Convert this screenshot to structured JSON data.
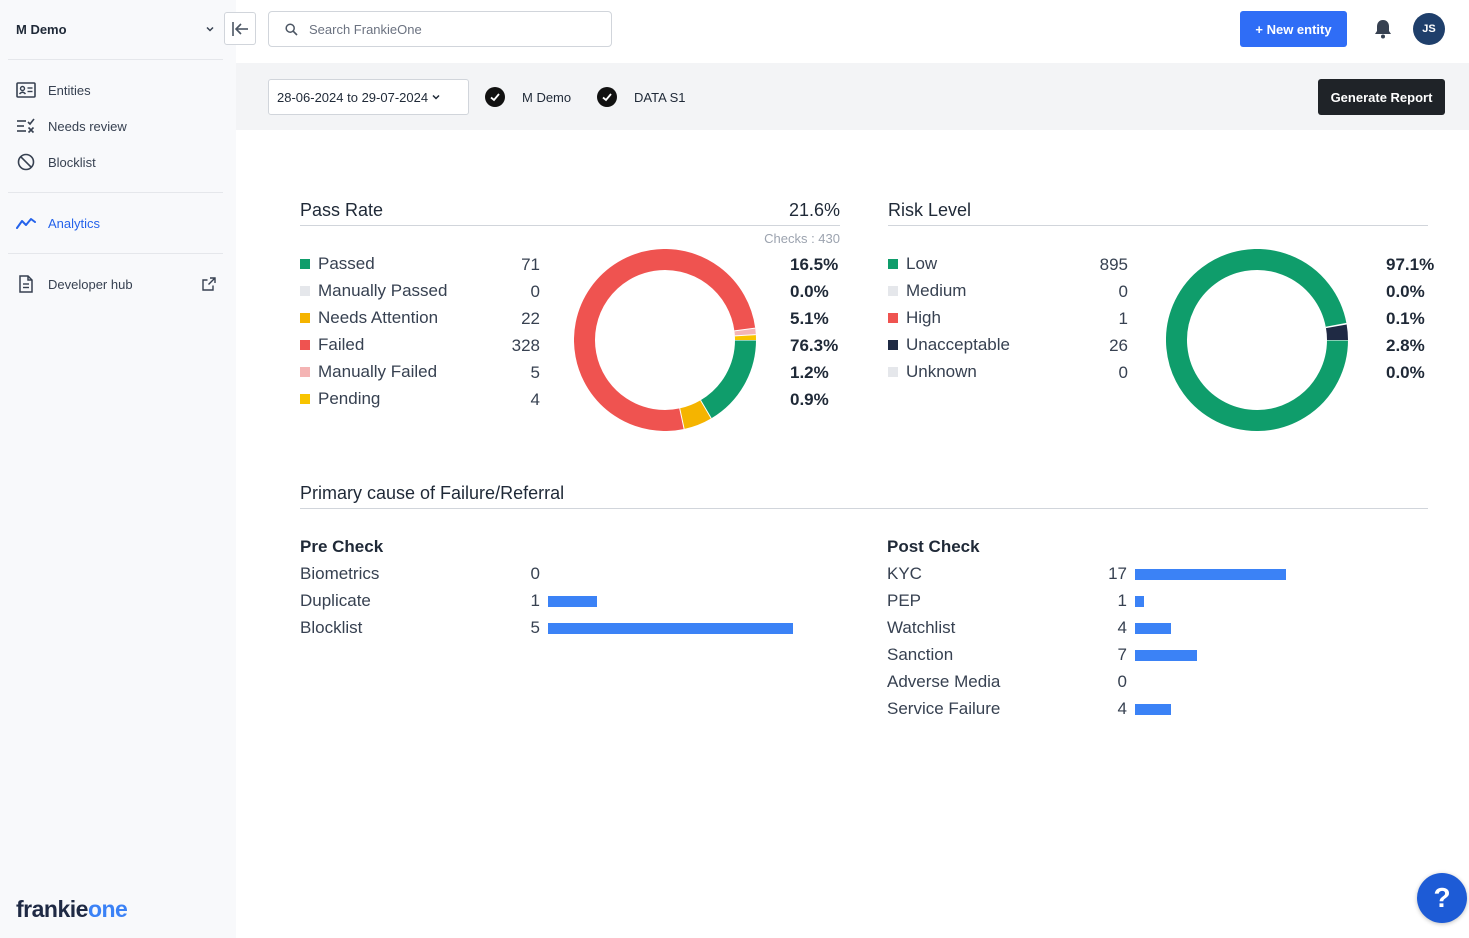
{
  "sidebar": {
    "org_name": "M Demo",
    "nav": [
      {
        "label": "Entities",
        "icon": "id-card-icon"
      },
      {
        "label": "Needs review",
        "icon": "review-list-icon"
      },
      {
        "label": "Blocklist",
        "icon": "block-icon"
      },
      {
        "label": "Analytics",
        "icon": "analytics-icon",
        "active": true
      },
      {
        "label": "Developer hub",
        "icon": "document-icon"
      }
    ],
    "brand_part1": "frankie",
    "brand_part2": "one"
  },
  "topbar": {
    "search_placeholder": "Search FrankieOne",
    "new_entity_label": "+ New entity",
    "avatar_initials": "JS"
  },
  "filters": {
    "date_range": "28-06-2024 to 29-07-2024",
    "chips": [
      "M Demo",
      "DATA S1"
    ],
    "generate_report_label": "Generate Report"
  },
  "pass_rate": {
    "title": "Pass Rate",
    "value": "21.6%",
    "checks_label": "Checks : 430",
    "items": [
      {
        "label": "Passed",
        "count": "71",
        "pct": "16.5%",
        "color": "#0f9d6b",
        "value": 71
      },
      {
        "label": "Manually Passed",
        "count": "0",
        "pct": "0.0%",
        "color": "#e5e7eb",
        "value": 0
      },
      {
        "label": "Needs Attention",
        "count": "22",
        "pct": "5.1%",
        "color": "#f5b400",
        "value": 22
      },
      {
        "label": "Failed",
        "count": "328",
        "pct": "76.3%",
        "color": "#ef5350",
        "value": 328
      },
      {
        "label": "Manually Failed",
        "count": "5",
        "pct": "1.2%",
        "color": "#f4b4b4",
        "value": 5
      },
      {
        "label": "Pending",
        "count": "4",
        "pct": "0.9%",
        "color": "#f8c400",
        "value": 4
      }
    ]
  },
  "risk_level": {
    "title": "Risk Level",
    "items": [
      {
        "label": "Low",
        "count": "895",
        "pct": "97.1%",
        "color": "#0f9d6b",
        "value": 895
      },
      {
        "label": "Medium",
        "count": "0",
        "pct": "0.0%",
        "color": "#e5e7eb",
        "value": 0
      },
      {
        "label": "High",
        "count": "1",
        "pct": "0.1%",
        "color": "#ef5350",
        "value": 1
      },
      {
        "label": "Unacceptable",
        "count": "26",
        "pct": "2.8%",
        "color": "#1f2a44",
        "value": 26
      },
      {
        "label": "Unknown",
        "count": "0",
        "pct": "0.0%",
        "color": "#e5e7eb",
        "value": 0
      }
    ]
  },
  "failure": {
    "title": "Primary cause of Failure/Referral",
    "pre_check": {
      "heading": "Pre Check",
      "rows": [
        {
          "label": "Biometrics",
          "count": "0",
          "value": 0
        },
        {
          "label": "Duplicate",
          "count": "1",
          "value": 1
        },
        {
          "label": "Blocklist",
          "count": "5",
          "value": 5
        }
      ]
    },
    "post_check": {
      "heading": "Post Check",
      "rows": [
        {
          "label": "KYC",
          "count": "17",
          "value": 17
        },
        {
          "label": "PEP",
          "count": "1",
          "value": 1
        },
        {
          "label": "Watchlist",
          "count": "4",
          "value": 4
        },
        {
          "label": "Sanction",
          "count": "7",
          "value": 7
        },
        {
          "label": "Adverse Media",
          "count": "0",
          "value": 0
        },
        {
          "label": "Service Failure",
          "count": "4",
          "value": 4
        }
      ]
    },
    "bar_color": "#3b82f6"
  },
  "help_label": "?"
}
